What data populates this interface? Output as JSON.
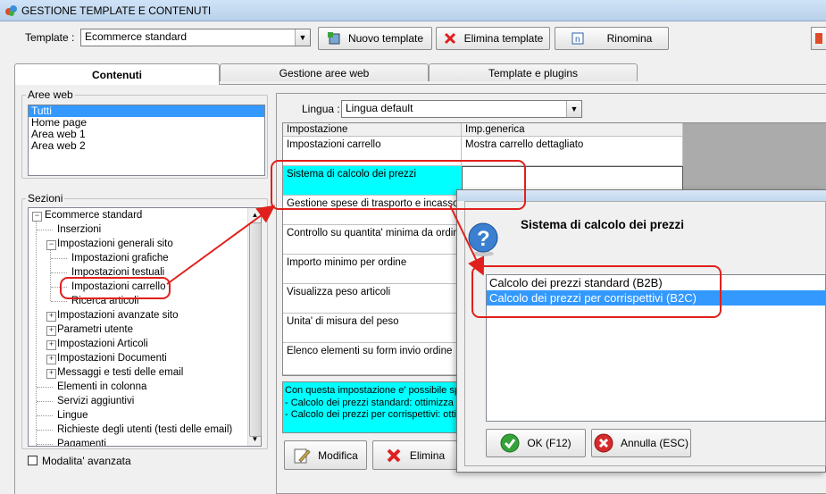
{
  "window": {
    "title": "GESTIONE TEMPLATE E CONTENUTI"
  },
  "template_row": {
    "label": "Template :",
    "selected": "Ecommerce standard",
    "btn_new": "Nuovo template",
    "btn_delete": "Elimina template",
    "btn_rename": "Rinomina"
  },
  "tabs": [
    "Contenuti",
    "Gestione aree web",
    "Template e plugins"
  ],
  "aree_web": {
    "label": "Aree web",
    "items": [
      "Tutti",
      "Home page",
      "Area web 1",
      "Area web 2"
    ]
  },
  "sezioni": {
    "label": "Sezioni",
    "items": [
      "Ecommerce standard",
      "Inserzioni",
      "Impostazioni generali sito",
      "Impostazioni grafiche",
      "Impostazioni testuali",
      "Impostazioni carrello",
      "Ricerca articoli",
      "Impostazioni avanzate sito",
      "Parametri utente",
      "Impostazioni Articoli",
      "Impostazioni Documenti",
      "Messaggi e testi delle email",
      "Elementi in colonna",
      "Servizi aggiuntivi",
      "Lingue",
      "Richieste degli utenti (testi delle email)",
      "Pagamenti"
    ]
  },
  "advanced_checkbox": "Modalita' avanzata",
  "lingua": {
    "label": "Lingua :",
    "selected": "Lingua default"
  },
  "grid": {
    "headers": [
      "Impostazione",
      "Imp.generica"
    ],
    "rows": [
      {
        "name": "Impostazioni carrello",
        "value": "Mostra carrello dettagliato"
      },
      {
        "name": "Sistema di calcolo dei prezzi",
        "value": ""
      },
      {
        "name": "Gestione spese di trasporto e incasso",
        "value": ""
      },
      {
        "name": "Controllo su quantita' minima da ordinare",
        "value": ""
      },
      {
        "name": "Importo minimo per ordine",
        "value": ""
      },
      {
        "name": "Visualizza peso articoli",
        "value": ""
      },
      {
        "name": "Unita' di misura del peso",
        "value": ""
      },
      {
        "name": "Elenco elementi su form invio ordine",
        "value": ""
      }
    ]
  },
  "description": [
    "Con questa impostazione e' possibile sp",
    "- Calcolo dei prezzi standard: ottimizza l",
    "- Calcolo dei prezzi per corrispettivi: otti"
  ],
  "bottom_buttons": {
    "edit": "Modifica",
    "delete": "Elimina"
  },
  "dialog": {
    "title": "Sistema di calcolo dei prezzi",
    "options": [
      "Calcolo dei prezzi standard (B2B)",
      "Calcolo dei prezzi per corrispettivi (B2C)"
    ],
    "ok": "OK (F12)",
    "cancel": "Annulla (ESC)"
  },
  "colors": {
    "selection": "#3399ff",
    "highlight_cyan": "#00ffff",
    "annotation_red": "#e0201c",
    "description_bg": "#00ffff"
  }
}
